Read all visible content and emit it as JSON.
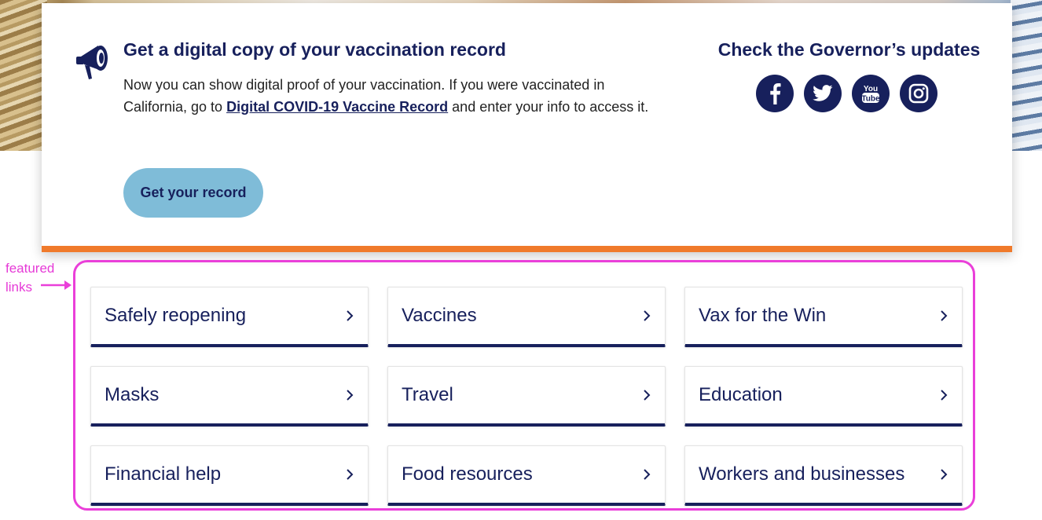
{
  "banner": {
    "title": "Get a digital copy of your vaccination record",
    "text_before": "Now you can show digital proof of your vaccination. If you were vaccinated in California, go to ",
    "link_text": "Digital COVID-19 Vaccine Record",
    "text_after": " and enter your info to access it.",
    "button_label": "Get your record",
    "icon": "megaphone-icon",
    "accent_color": "#f07a2b"
  },
  "governor": {
    "title": "Check the Governor’s updates",
    "social": [
      "facebook-icon",
      "twitter-icon",
      "youtube-icon",
      "instagram-icon"
    ],
    "youtube_top": "You",
    "youtube_bottom": "Tube"
  },
  "annotation": {
    "line1": "featured",
    "line2": "links",
    "color": "#ea3fd9"
  },
  "featured_links": [
    {
      "label": "Safely reopening"
    },
    {
      "label": "Vaccines"
    },
    {
      "label": "Vax for the Win"
    },
    {
      "label": "Masks"
    },
    {
      "label": "Travel"
    },
    {
      "label": "Education"
    },
    {
      "label": "Financial help"
    },
    {
      "label": "Food resources"
    },
    {
      "label": "Workers and businesses"
    }
  ],
  "colors": {
    "navy": "#17205c",
    "button_bg": "#7fbcd8"
  }
}
